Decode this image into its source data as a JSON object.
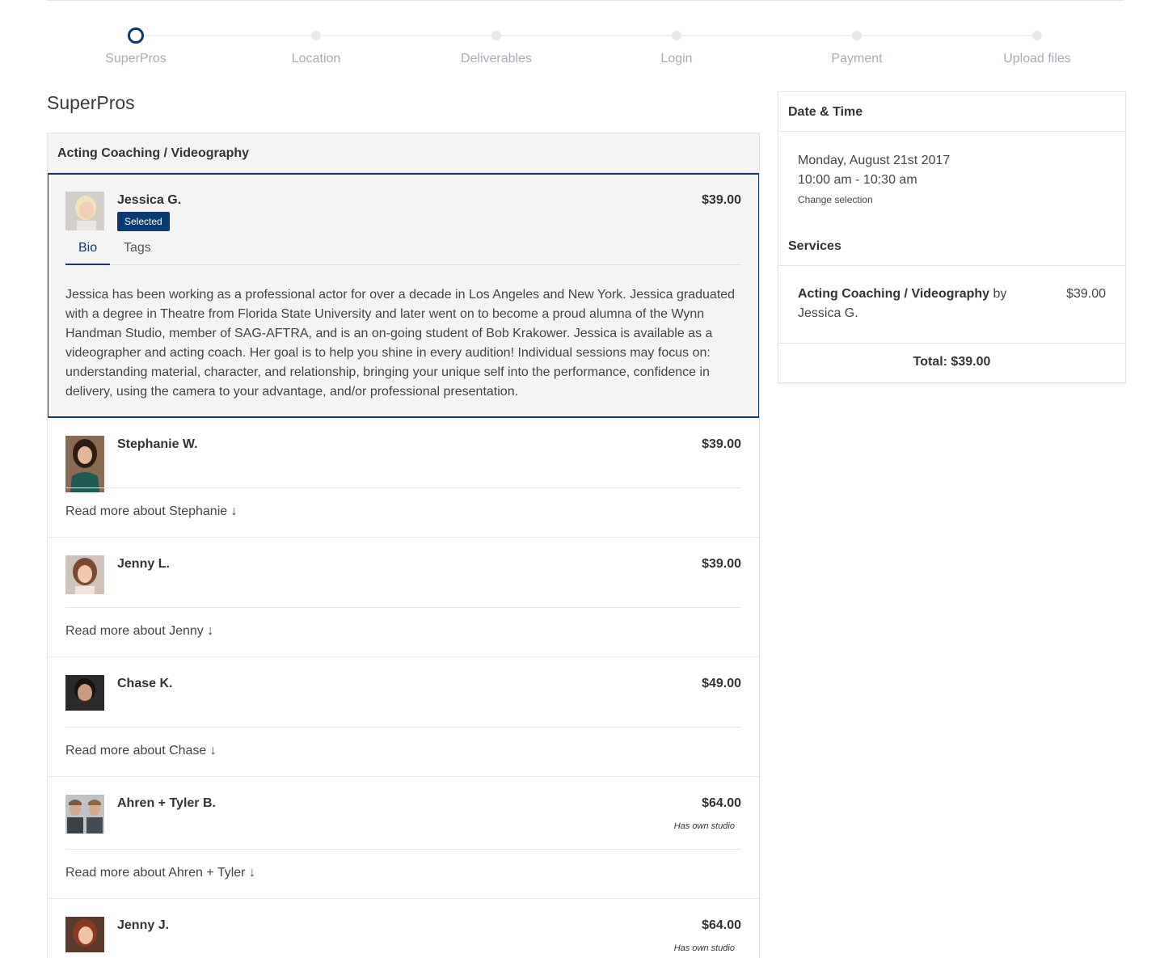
{
  "stepper": {
    "steps": [
      {
        "label": "SuperPros",
        "active": true
      },
      {
        "label": "Location",
        "active": false
      },
      {
        "label": "Deliverables",
        "active": false
      },
      {
        "label": "Login",
        "active": false
      },
      {
        "label": "Payment",
        "active": false
      },
      {
        "label": "Upload files",
        "active": false
      }
    ]
  },
  "page_title": "SuperPros",
  "category": "Acting Coaching / Videography",
  "selected_pro": {
    "name": "Jessica G.",
    "price": "$39.00",
    "badge": "Selected",
    "tabs": [
      "Bio",
      "Tags"
    ],
    "bio": "Jessica has been working as a professional actor for over a decade in Los Angeles and New York. Jessica graduated with a degree in Theatre from Florida State University and later went on to become a proud alumna of the Wynn Handman Studio, member of SAG-AFTRA, and is an on-going student of Bob Krakower. Jessica is available as a videographer and acting coach. Her goal is to help you shine in every audition! Individual sessions may focus on: understanding material, character, and relationship, bringing your unique self into the performance, confidence in delivery, using the camera to your advantage, and/or professional presentation."
  },
  "pros": [
    {
      "name": "Stephanie W.",
      "price": "$39.00",
      "read_more": "Read more about Stephanie ↓",
      "studio": ""
    },
    {
      "name": "Jenny L.",
      "price": "$39.00",
      "read_more": "Read more about Jenny ↓",
      "studio": ""
    },
    {
      "name": "Chase K.",
      "price": "$49.00",
      "read_more": "Read more about Chase ↓",
      "studio": ""
    },
    {
      "name": "Ahren + Tyler B.",
      "price": "$64.00",
      "read_more": "Read more about Ahren + Tyler ↓",
      "studio": "Has own studio"
    },
    {
      "name": "Jenny J.",
      "price": "$64.00",
      "read_more": "",
      "studio": "Has own studio"
    }
  ],
  "sidebar": {
    "date_time_heading": "Date & Time",
    "date": "Monday, August 21st 2017",
    "time": "10:00 am - 10:30 am",
    "change_selection": "Change selection",
    "services_heading": "Services",
    "service_name": "Acting Coaching / Videography",
    "service_by": " by ",
    "service_pro": "Jessica G.",
    "service_price": "$39.00",
    "total": "Total: $39.00"
  },
  "colors": {
    "accent": "#0b3a72",
    "panel_bg": "#f4f4f4",
    "border": "#e3e3e3",
    "muted_text": "#a7adb7"
  }
}
